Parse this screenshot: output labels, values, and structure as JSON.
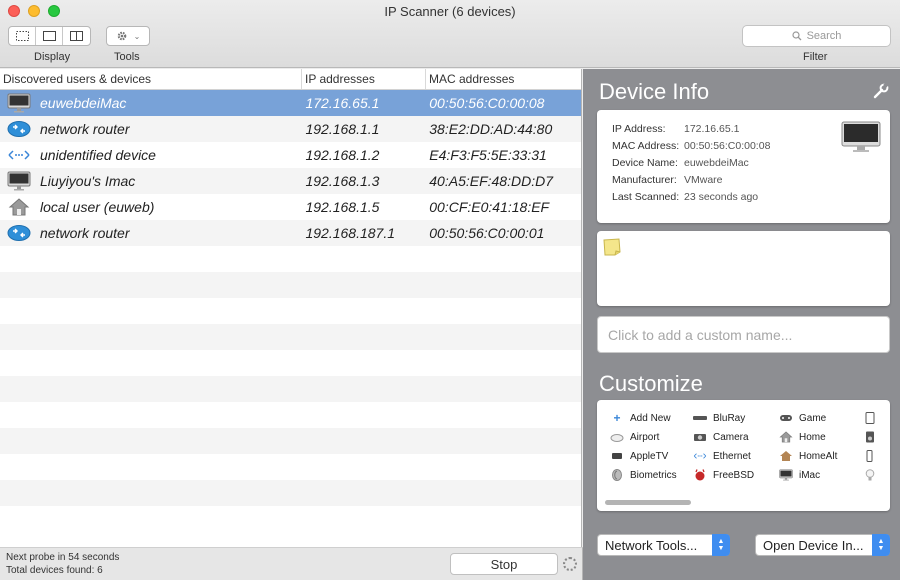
{
  "window": {
    "title": "IP Scanner (6 devices)"
  },
  "toolbar": {
    "display_label": "Display",
    "tools_label": "Tools",
    "filter_label": "Filter",
    "search_placeholder": "Search"
  },
  "table": {
    "columns": [
      "Discovered users & devices",
      "IP addresses",
      "MAC addresses"
    ],
    "rows": [
      {
        "icon": "imac-icon",
        "name": "euwebdeiMac",
        "ip": "172.16.65.1",
        "mac": "00:50:56:C0:00:08",
        "selected": true
      },
      {
        "icon": "router-icon",
        "name": "network router",
        "ip": "192.168.1.1",
        "mac": "38:E2:DD:AD:44:80"
      },
      {
        "icon": "ethernet-icon",
        "name": "unidentified device",
        "ip": "192.168.1.2",
        "mac": "E4:F3:F5:5E:33:31"
      },
      {
        "icon": "imac-icon",
        "name": "Liuyiyou's Imac",
        "ip": "192.168.1.3",
        "mac": "40:A5:EF:48:DD:D7"
      },
      {
        "icon": "home-icon",
        "name": "local user (euweb)",
        "ip": "192.168.1.5",
        "mac": "00:CF:E0:41:18:EF"
      },
      {
        "icon": "router-icon",
        "name": "network router",
        "ip": "192.168.187.1",
        "mac": "00:50:56:C0:00:01"
      }
    ]
  },
  "status": {
    "next_probe": "Next probe in 54 seconds",
    "total_found": "Total devices found: 6",
    "stop_label": "Stop"
  },
  "device_info": {
    "title": "Device Info",
    "ip_label": "IP Address:",
    "ip_value": "172.16.65.1",
    "mac_label": "MAC Address:",
    "mac_value": "00:50:56:C0:00:08",
    "name_label": "Device Name:",
    "name_value": "euwebdeiMac",
    "manufacturer_label": "Manufacturer:",
    "manufacturer_value": "VMware",
    "scanned_label": "Last Scanned:",
    "scanned_value": "23 seconds ago",
    "custom_name_placeholder": "Click to add a custom name..."
  },
  "customize": {
    "title": "Customize",
    "items": [
      {
        "label": "Add New",
        "icon": "plus-icon"
      },
      {
        "label": "BluRay",
        "icon": "bluray-icon"
      },
      {
        "label": "Game",
        "icon": "gamepad-icon"
      },
      {
        "label": "Airport",
        "icon": "airport-icon"
      },
      {
        "label": "Camera",
        "icon": "camera-icon"
      },
      {
        "label": "Home",
        "icon": "home-icon"
      },
      {
        "label": "AppleTV",
        "icon": "appletv-icon"
      },
      {
        "label": "Ethernet",
        "icon": "ethernet-icon"
      },
      {
        "label": "HomeAlt",
        "icon": "homealt-icon"
      },
      {
        "label": "Biometrics",
        "icon": "fingerprint-icon"
      },
      {
        "label": "FreeBSD",
        "icon": "freebsd-icon"
      },
      {
        "label": "iMac",
        "icon": "imac-icon"
      }
    ]
  },
  "actions": {
    "network_tools": "Network Tools...",
    "open_device": "Open Device In..."
  }
}
